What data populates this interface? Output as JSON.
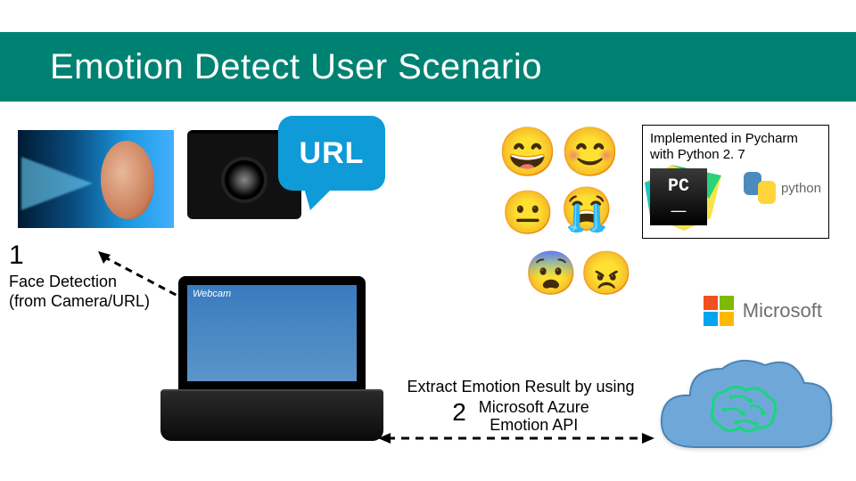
{
  "title": "Emotion Detect User Scenario",
  "url_bubble": "URL",
  "info_box": {
    "text": "Implemented in Pycharm with Python 2. 7",
    "pycharm_label_top": "PC",
    "pycharm_label_bottom": "_",
    "python_label": "python"
  },
  "step1": {
    "number": "1",
    "caption_line1": "Face Detection",
    "caption_line2": "(from Camera/URL)"
  },
  "laptop_window_title": "Webcam",
  "microsoft_label": "Microsoft",
  "step2": {
    "line1": "Extract Emotion Result by using",
    "number": "2",
    "line2": "Microsoft Azure",
    "line3": "Emotion API"
  },
  "emoji": {
    "grin": "😄",
    "smile": "😊",
    "neutral": "😐",
    "crying": "😭",
    "fearful": "😨",
    "angry": "😠"
  }
}
